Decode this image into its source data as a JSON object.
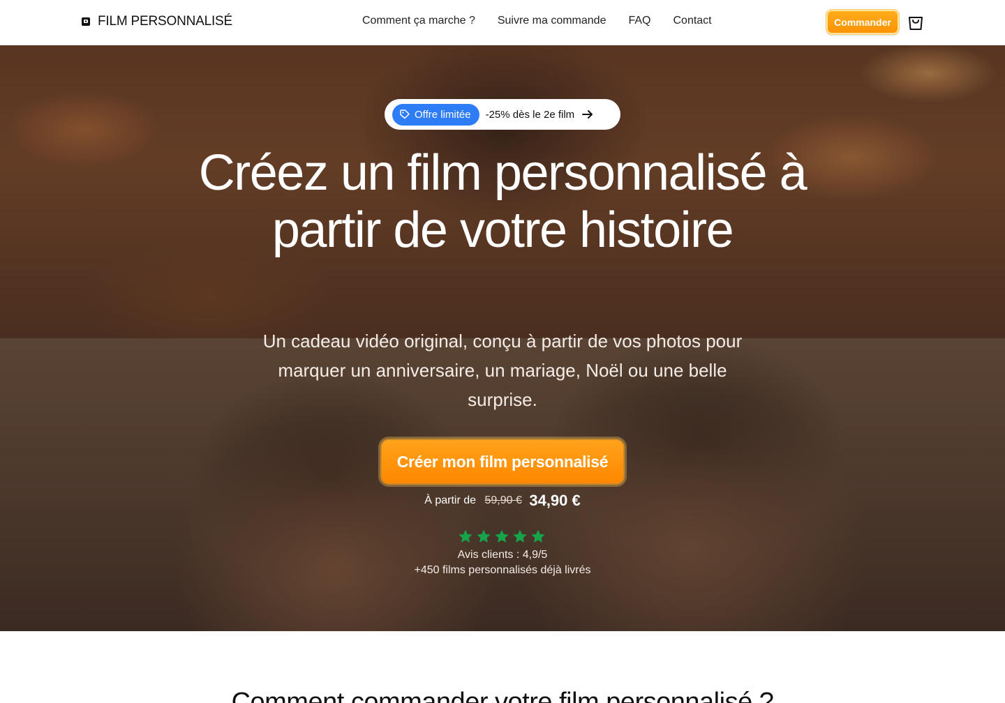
{
  "header": {
    "brand": "FILM PERSONNALISÉ",
    "nav": [
      {
        "label": "Comment ça marche ?"
      },
      {
        "label": "Suivre ma commande"
      },
      {
        "label": "FAQ"
      },
      {
        "label": "Contact"
      }
    ],
    "order_button": "Commander",
    "cart_icon": "shopping-bag-icon"
  },
  "hero": {
    "offer_tag": "Offre limitée",
    "offer_text": "-25% dès le 2e film",
    "headline": "Créez un film personnalisé à partir de votre histoire",
    "subline": "Un cadeau vidéo original, conçu à partir de vos photos pour marquer un anniversaire, un mariage, Noël ou une belle surprise.",
    "cta": "Créer mon film personnalisé",
    "price_from": "À partir de",
    "price_old": "59,90 €",
    "price_new": "34,90 €",
    "stars": 5,
    "rating": "Avis clients : 4,9/5",
    "delivered": "+450 films personnalisés déjà livrés"
  },
  "next_section": {
    "title": "Comment commander votre film personnalisé ?"
  },
  "colors": {
    "accent_orange": "#ff9100",
    "offer_blue": "#2f7df6",
    "star_green": "#16a34a"
  }
}
